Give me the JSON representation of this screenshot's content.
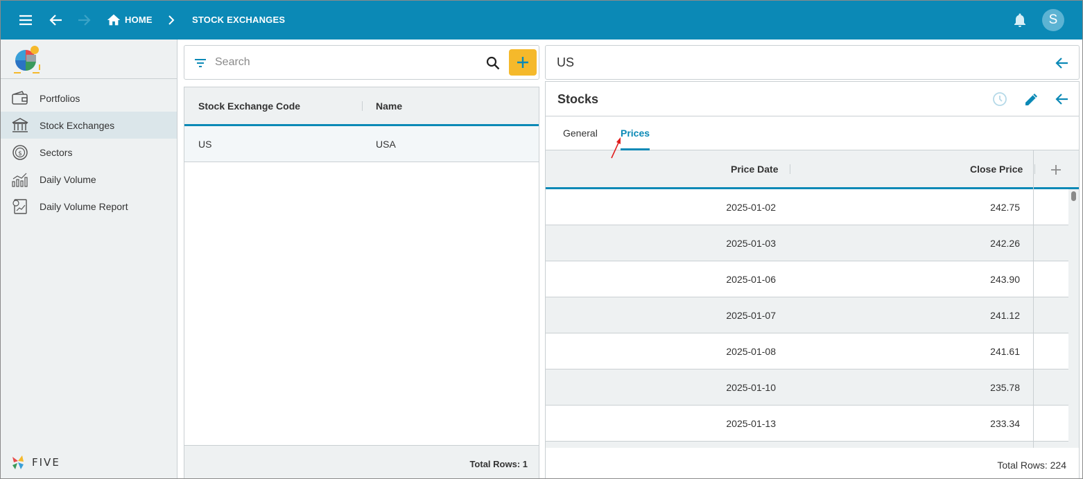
{
  "header": {
    "breadcrumb_home": "HOME",
    "breadcrumb_current": "STOCK EXCHANGES",
    "avatar_letter": "S",
    "icons": [
      "menu-icon",
      "back-arrow-icon",
      "forward-arrow-icon",
      "home-icon",
      "chevron-right-icon",
      "bell-icon"
    ],
    "bar_color": "#0b89b6"
  },
  "sidebar": {
    "items": [
      {
        "label": "Portfolios",
        "icon": "wallet-icon"
      },
      {
        "label": "Stock Exchanges",
        "icon": "bank-icon"
      },
      {
        "label": "Sectors",
        "icon": "dollar-circle-icon"
      },
      {
        "label": "Daily Volume",
        "icon": "bar-chart-icon"
      },
      {
        "label": "Daily Volume Report",
        "icon": "report-icon"
      }
    ],
    "active": "Stock Exchanges",
    "brand_text": "FIVE"
  },
  "list": {
    "search_placeholder": "Search",
    "columns": [
      "Stock Exchange Code",
      "Name"
    ],
    "rows": [
      {
        "code": "US",
        "name": "USA"
      }
    ],
    "total_label": "Total Rows: 1",
    "add_button_color": "#f5b92b"
  },
  "detail": {
    "title": "US",
    "sub_title": "Stocks",
    "tabs": [
      "General",
      "Prices"
    ],
    "active_tab": "Prices",
    "columns": [
      "Price Date",
      "Close Price"
    ],
    "rows": [
      {
        "date": "2025-01-02",
        "price": "242.75"
      },
      {
        "date": "2025-01-03",
        "price": "242.26"
      },
      {
        "date": "2025-01-06",
        "price": "243.90"
      },
      {
        "date": "2025-01-07",
        "price": "241.12"
      },
      {
        "date": "2025-01-08",
        "price": "241.61"
      },
      {
        "date": "2025-01-10",
        "price": "235.78"
      },
      {
        "date": "2025-01-13",
        "price": "233.34"
      }
    ],
    "total_label": "Total Rows: 224"
  }
}
